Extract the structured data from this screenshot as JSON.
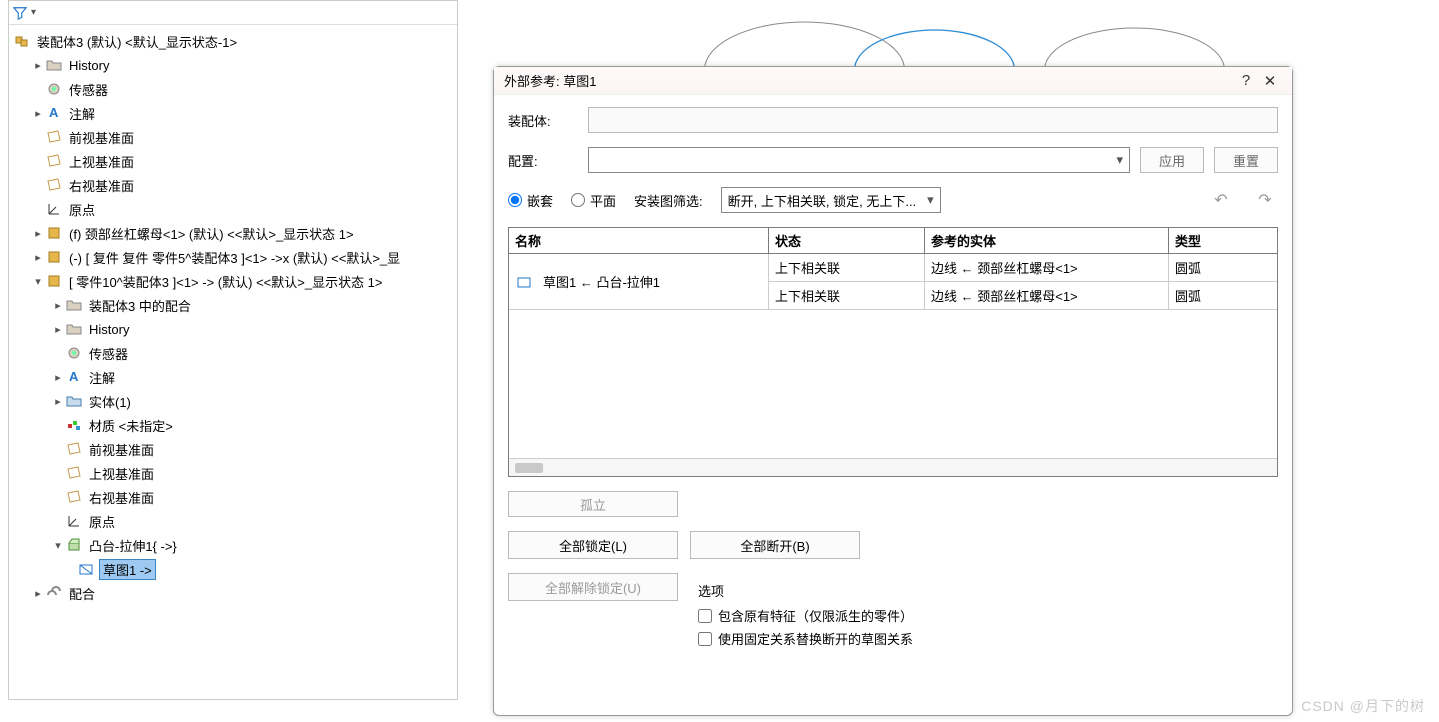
{
  "tree": {
    "root": "装配体3 (默认) <默认_显示状态-1>",
    "history": "History",
    "sensors": "传感器",
    "annotations": "注解",
    "plane_front": "前视基准面",
    "plane_top": "上视基准面",
    "plane_right": "右视基准面",
    "origin": "原点",
    "part_f": "(f) 颈部丝杠螺母<1> (默认) <<默认>_显示状态 1>",
    "part_mirror": "(-) [ 复件 复件 零件5^装配体3 ]<1> ->x (默认) <<默认>_显",
    "part10": "[ 零件10^装配体3 ]<1> -> (默认) <<默认>_显示状态 1>",
    "sub_mates": "装配体3 中的配合",
    "sub_history": "History",
    "sub_sensors": "传感器",
    "sub_annot": "注解",
    "sub_solid": "实体(1)",
    "sub_material": "材质 <未指定>",
    "sub_plane_front": "前视基准面",
    "sub_plane_top": "上视基准面",
    "sub_plane_right": "右视基准面",
    "sub_origin": "原点",
    "boss": "凸台-拉伸1{ ->}",
    "sketch": "草图1 ->",
    "mates": "配合"
  },
  "dialog": {
    "title": "外部参考:   草图1",
    "assembly_label": "装配体:",
    "config_label": "配置:",
    "apply": "应用",
    "reset": "重置",
    "nested": "嵌套",
    "flat": "平面",
    "filter_label": "安装图筛选:",
    "filter_value": "断开, 上下相关联, 锁定, 无上下...",
    "col_name": "名称",
    "col_state": "状态",
    "col_ref": "参考的实体",
    "col_type": "类型",
    "row_name": "草图1 ← 凸台-拉伸1",
    "row1_state": "上下相关联",
    "row1_ref": "边线 ← 颈部丝杠螺母<1>",
    "row1_type": "圆弧",
    "row2_state": "上下相关联",
    "row2_ref": "边线 ← 颈部丝杠螺母<1>",
    "row2_type": "圆弧",
    "isolate": "孤立",
    "lock_all": "全部锁定(L)",
    "break_all": "全部断开(B)",
    "unlock_all": "全部解除锁定(U)",
    "options": "选项",
    "opt1": "包含原有特征（仅限派生的零件）",
    "opt2": "使用固定关系替换断开的草图关系"
  },
  "watermark": "CSDN @月下的树"
}
